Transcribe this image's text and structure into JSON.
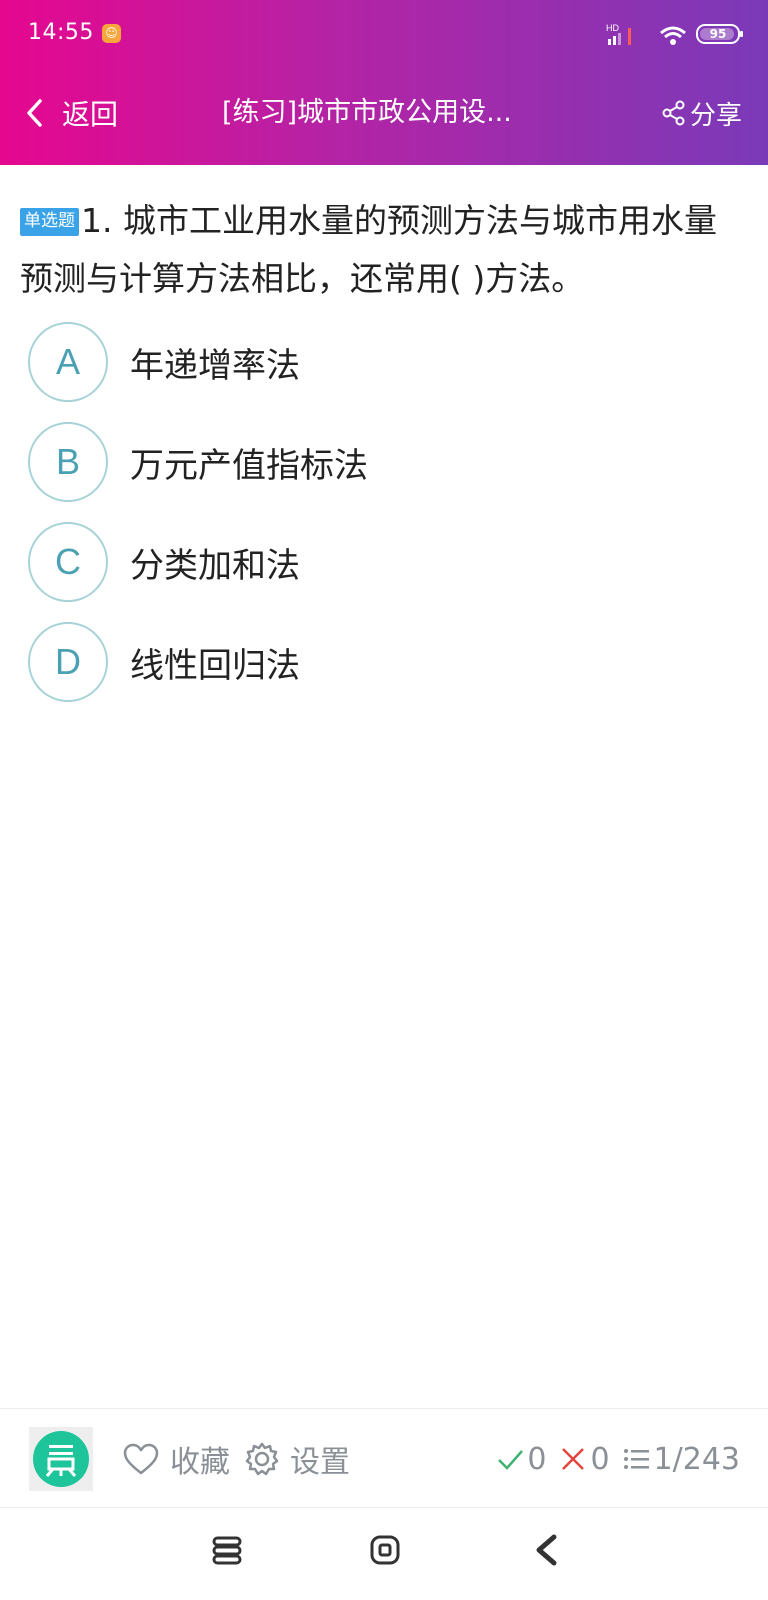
{
  "status_bar": {
    "time": "14:55",
    "signal_label": "HD",
    "battery_level": "95",
    "app_icon_glyph": "☺"
  },
  "nav": {
    "back_label": "返回",
    "title": "[练习]城市市政公用设...",
    "share_label": "分享"
  },
  "question": {
    "type_badge": "单选题",
    "text": "1. 城市工业用水量的预测方法与城市用水量预测与计算方法相比，还常用( )方法。"
  },
  "options": [
    {
      "letter": "A",
      "text": "年递增率法"
    },
    {
      "letter": "B",
      "text": "万元产值指标法"
    },
    {
      "letter": "C",
      "text": "分类加和法"
    },
    {
      "letter": "D",
      "text": "线性回归法"
    }
  ],
  "footer": {
    "favorite_label": "收藏",
    "settings_label": "设置",
    "correct_count": "0",
    "wrong_count": "0",
    "progress": "1/243"
  },
  "colors": {
    "header_gradient": [
      "#e6078f",
      "#7a3ab8"
    ],
    "option_ring": "#a6d2d8",
    "option_letter": "#4aa1b3",
    "badge": "#3aa3e8",
    "correct": "#3cb371",
    "wrong": "#e0463c",
    "logo": "#1ec49a"
  },
  "icons": [
    "back-chevron-icon",
    "share-icon",
    "heart-icon",
    "gear-icon",
    "check-icon",
    "cross-icon",
    "list-icon",
    "menu-icon",
    "home-icon",
    "back-triangle-icon"
  ]
}
